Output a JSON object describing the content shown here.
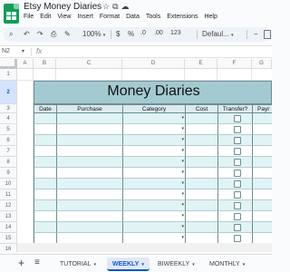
{
  "app": {
    "doc_title": "Etsy Money Diaries",
    "menu": [
      "File",
      "Edit",
      "View",
      "Insert",
      "Format",
      "Data",
      "Tools",
      "Extensions",
      "Help"
    ]
  },
  "toolbar": {
    "zoom": "100%",
    "currency": "$",
    "percent": "%",
    "decrease_decimal": ".0",
    "increase_decimal": ".00",
    "number_format": "123",
    "font": "Defaul..."
  },
  "formula_bar": {
    "cell_ref": "N2",
    "fx": "fx",
    "value": ""
  },
  "grid": {
    "columns": [
      "A",
      "B",
      "C",
      "D",
      "E",
      "F",
      "G"
    ],
    "selected_row": "2",
    "rows": [
      "1",
      "2",
      "3",
      "4",
      "5",
      "6",
      "7",
      "8",
      "9",
      "10",
      "11",
      "12",
      "13",
      "14",
      "15",
      "16"
    ]
  },
  "table": {
    "title": "Money Diaries",
    "headers": [
      "Date",
      "Purchase",
      "Category",
      "Cost",
      "Transfer?",
      "Payr"
    ]
  },
  "tabs": [
    {
      "label": "TUTORIAL",
      "active": false
    },
    {
      "label": "WEEKLY",
      "active": true
    },
    {
      "label": "BIWEEKLY",
      "active": false
    },
    {
      "label": "MONTHLY",
      "active": false
    }
  ],
  "colors": {
    "banner": "#a3c9d1",
    "row_stripe": "#e0f4f6",
    "border": "#6e8d94",
    "accent": "#0b57d0"
  }
}
